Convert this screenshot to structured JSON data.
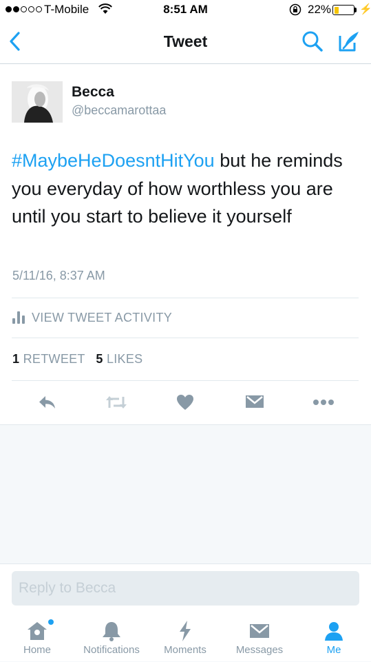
{
  "status_bar": {
    "carrier": "T-Mobile",
    "time": "8:51 AM",
    "battery": "22%",
    "battery_level": 0.22
  },
  "nav": {
    "title": "Tweet",
    "back_icon": "chevron-left-icon",
    "search_icon": "search-icon",
    "compose_icon": "compose-icon"
  },
  "tweet": {
    "author_name": "Becca",
    "author_handle": "@beccamarottaa",
    "hashtag": "#MaybeHeDoesntHitYou",
    "text": " but he reminds you everyday of how worthless you are until you start to believe it yourself",
    "timestamp": "5/11/16, 8:37 AM",
    "activity_label": "VIEW TWEET ACTIVITY",
    "retweet_count": "1",
    "retweet_label": "RETWEET",
    "like_count": "5",
    "like_label": "LIKES"
  },
  "actions": [
    "reply-icon",
    "retweet-icon",
    "like-icon",
    "direct-message-icon",
    "more-icon"
  ],
  "reply": {
    "placeholder": "Reply to Becca"
  },
  "tabs": [
    {
      "label": "Home",
      "icon": "home-icon"
    },
    {
      "label": "Notifications",
      "icon": "notifications-icon"
    },
    {
      "label": "Moments",
      "icon": "moments-icon"
    },
    {
      "label": "Messages",
      "icon": "messages-icon"
    },
    {
      "label": "Me",
      "icon": "me-icon"
    }
  ],
  "colors": {
    "accent": "#1da1f2",
    "muted": "#8899a6",
    "text": "#14171a",
    "battery": "#f5c400"
  }
}
